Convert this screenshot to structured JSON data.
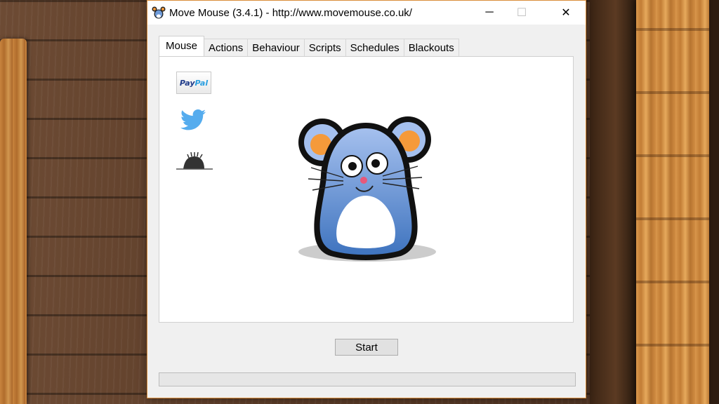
{
  "window": {
    "title": "Move Mouse (3.4.1) - http://www.movemouse.co.uk/",
    "minimize_glyph": "─",
    "maximize_glyph": "☐",
    "close_glyph": "✕",
    "icon": "mouse-app-icon"
  },
  "tabs": [
    {
      "label": "Mouse",
      "active": true
    },
    {
      "label": "Actions",
      "active": false
    },
    {
      "label": "Behaviour",
      "active": false
    },
    {
      "label": "Scripts",
      "active": false
    },
    {
      "label": "Schedules",
      "active": false
    },
    {
      "label": "Blackouts",
      "active": false
    }
  ],
  "social": {
    "paypal": {
      "text_a": "Pay",
      "text_b": "Pal",
      "icon": "paypal-icon"
    },
    "twitter": {
      "icon": "twitter-bird-icon",
      "color": "#55acee"
    },
    "mole": {
      "icon": "molehill-icon"
    }
  },
  "mascot": {
    "icon": "mouse-mascot",
    "body_color": "#5b8fd4",
    "ear_color": "#f59a3a"
  },
  "start_button": {
    "label": "Start"
  },
  "progress": {
    "value": 0
  }
}
